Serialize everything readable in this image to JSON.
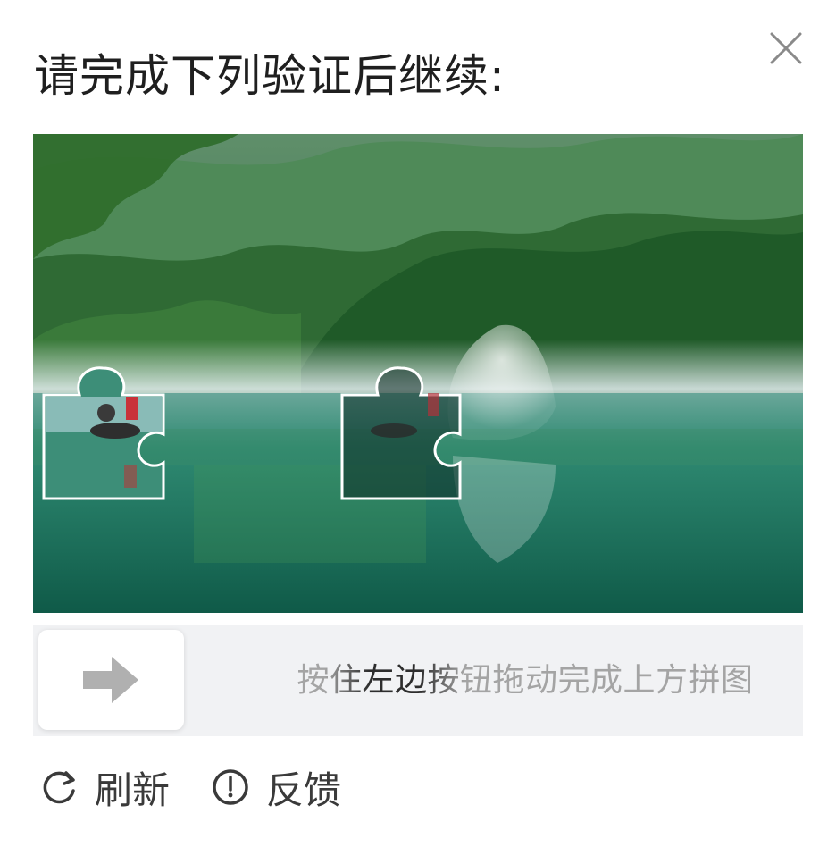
{
  "dialog": {
    "title": "请完成下列验证后继续:",
    "close_icon": "close-icon"
  },
  "puzzle": {
    "image_description_icon": "puzzle-background-image",
    "piece_icon": "puzzle-piece",
    "slot_icon": "puzzle-slot"
  },
  "slider": {
    "hint": "按住左边按钮拖动完成上方拼图",
    "handle_icon": "arrow-right-icon"
  },
  "footer": {
    "refresh_label": "刷新",
    "refresh_icon": "refresh-icon",
    "feedback_label": "反馈",
    "feedback_icon": "info-circle-icon"
  },
  "colors": {
    "track_bg": "#f1f2f4",
    "hint_text": "#a4a4a4",
    "title_text": "#1f1f1f",
    "icon_gray": "#b0b0b0"
  }
}
